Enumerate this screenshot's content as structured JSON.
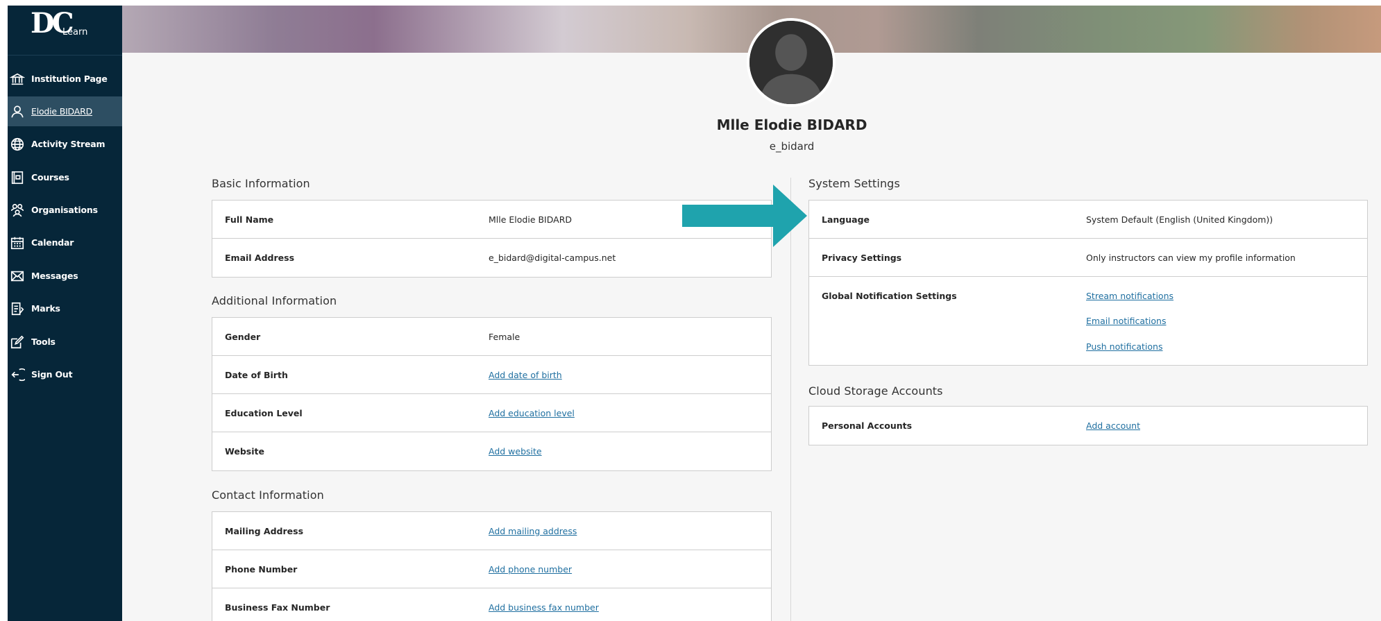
{
  "app": {
    "logo_mark": "DC",
    "logo_word": "Learn"
  },
  "sidebar": {
    "items": [
      {
        "label": "Institution Page",
        "icon": "institution-icon",
        "active": false
      },
      {
        "label": "Elodie BIDARD",
        "icon": "user-icon",
        "active": true
      },
      {
        "label": "Activity Stream",
        "icon": "globe-icon",
        "active": false
      },
      {
        "label": "Courses",
        "icon": "courses-icon",
        "active": false
      },
      {
        "label": "Organisations",
        "icon": "organisations-icon",
        "active": false
      },
      {
        "label": "Calendar",
        "icon": "calendar-icon",
        "active": false
      },
      {
        "label": "Messages",
        "icon": "envelope-icon",
        "active": false
      },
      {
        "label": "Marks",
        "icon": "marks-icon",
        "active": false
      },
      {
        "label": "Tools",
        "icon": "tools-icon",
        "active": false
      },
      {
        "label": "Sign Out",
        "icon": "sign-out-icon",
        "active": false
      }
    ]
  },
  "profile": {
    "full_name": "Mlle Elodie BIDARD",
    "username": "e_bidard"
  },
  "basic_information": {
    "title": "Basic Information",
    "rows": [
      {
        "label": "Full Name",
        "value": "Mlle Elodie BIDARD"
      },
      {
        "label": "Email Address",
        "value": "e_bidard@digital-campus.net"
      }
    ]
  },
  "additional_information": {
    "title": "Additional Information",
    "rows": [
      {
        "label": "Gender",
        "value": "Female"
      },
      {
        "label": "Date of Birth",
        "value": "Add date of birth"
      },
      {
        "label": "Education Level",
        "value": "Add education level"
      },
      {
        "label": "Website",
        "value": "Add website"
      }
    ]
  },
  "contact_information": {
    "title": "Contact Information",
    "rows": [
      {
        "label": "Mailing Address",
        "value": "Add mailing address"
      },
      {
        "label": "Phone Number",
        "value": "Add phone number"
      },
      {
        "label": "Business Fax Number",
        "value": "Add business fax number"
      }
    ]
  },
  "system_settings": {
    "title": "System Settings",
    "rows": [
      {
        "label": "Language",
        "value": "System Default (English (United Kingdom))"
      },
      {
        "label": "Privacy Settings",
        "value": "Only instructors can view my profile information"
      },
      {
        "label": "Global Notification Settings",
        "links": [
          "Stream notifications",
          "Email notifications",
          "Push notifications"
        ]
      }
    ]
  },
  "cloud_storage": {
    "title": "Cloud Storage Accounts",
    "rows": [
      {
        "label": "Personal Accounts",
        "value": "Add account"
      }
    ]
  },
  "colors": {
    "sidebar_bg": "#062639",
    "sidebar_active": "#2d4e62",
    "link": "#1f6fa0",
    "arrow": "#1fa3ad"
  }
}
